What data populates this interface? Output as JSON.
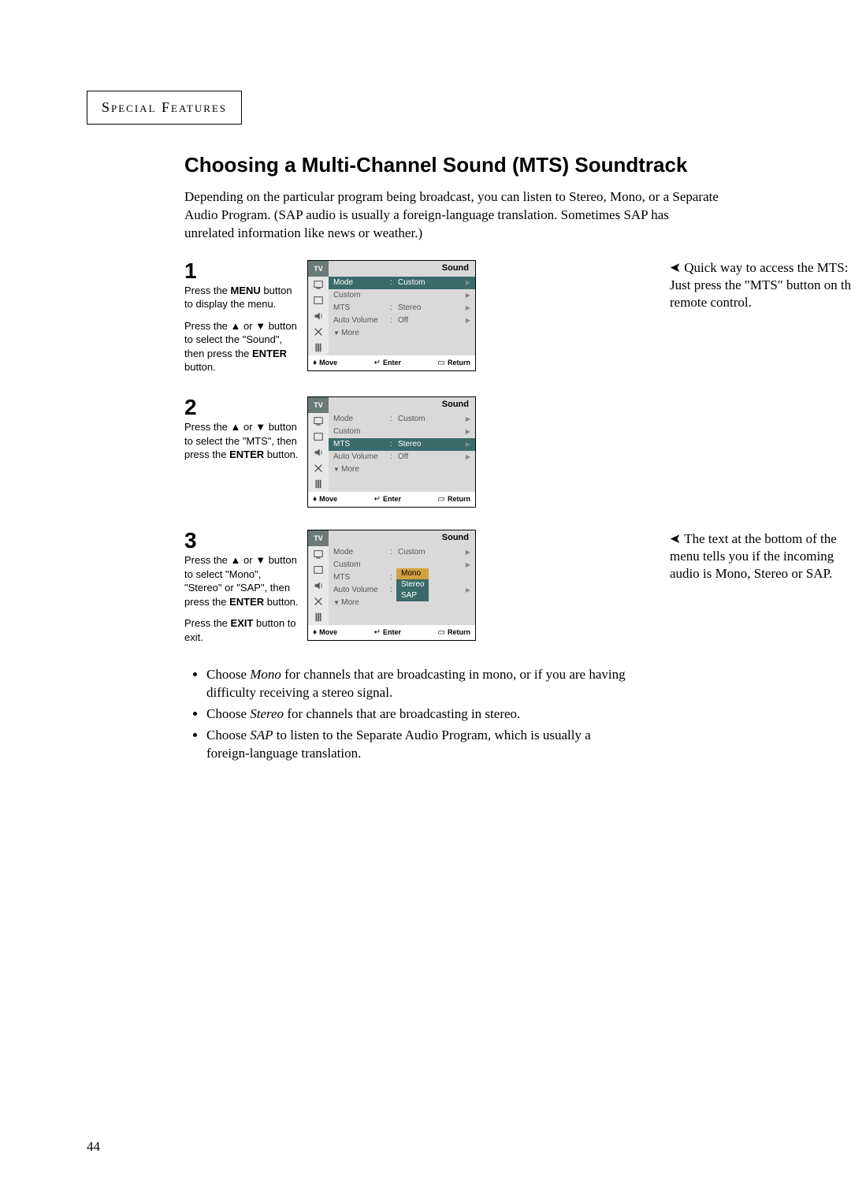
{
  "header": "Special Features",
  "title": "Choosing a Multi-Channel Sound (MTS) Soundtrack",
  "intro": "Depending on the particular program being broadcast, you can listen to Stereo, Mono, or a Separate Audio Program. (SAP audio is usually a foreign-language translation. Sometimes SAP has unrelated information like news or weather.)",
  "steps": {
    "s1": {
      "num": "1",
      "p1a": "Press the ",
      "p1b": "MENU",
      "p1c": " button to display the menu.",
      "p2a": "Press the ",
      "p2b": "▲",
      "p2c": " or ",
      "p2d": "▼",
      "p2e": " button to select the \"Sound\", then press the ",
      "p2f": "ENTER",
      "p2g": " button."
    },
    "s2": {
      "num": "2",
      "p1a": "Press the ",
      "p1b": "▲",
      "p1c": " or ",
      "p1d": "▼",
      "p1e": " button to select the \"MTS\", then press the ",
      "p1f": "ENTER",
      "p1g": " button."
    },
    "s3": {
      "num": "3",
      "p1a": "Press the ",
      "p1b": "▲",
      "p1c": " or ",
      "p1d": "▼",
      "p1e": " button to select \"Mono\", \"Stereo\" or \"SAP\", then press the ",
      "p1f": "ENTER",
      "p1g": " button.",
      "p2a": "Press the ",
      "p2b": "EXIT",
      "p2c": " button to exit."
    }
  },
  "osd": {
    "tv": "TV",
    "title": "Sound",
    "mode_l": "Mode",
    "mode_v": "Custom",
    "custom_l": "Custom",
    "mts_l": "MTS",
    "mts_v": "Stereo",
    "av_l": "Auto Volume",
    "av_v": "Off",
    "more_l": "More",
    "footer_move": "Move",
    "footer_enter": "Enter",
    "footer_return": "Return",
    "sub_mono": "Mono",
    "sub_stereo": "Stereo",
    "sub_sap": "SAP"
  },
  "notes": {
    "n1": "Quick way to access the MTS: Just press the \"MTS\" button on the remote control.",
    "n3": "The text at the bottom of the menu tells you if the incoming audio is Mono, Stereo or SAP."
  },
  "bullets": {
    "b1a": "Choose ",
    "b1i": "Mono",
    "b1b": " for channels that are broadcasting in mono, or if you are having difficulty receiving a stereo signal.",
    "b2a": "Choose ",
    "b2i": "Stereo",
    "b2b": " for channels that are broadcasting in stereo.",
    "b3a": "Choose ",
    "b3i": "SAP",
    "b3b": " to listen to the Separate Audio Program, which is usually a foreign-language translation."
  },
  "page_number": "44"
}
